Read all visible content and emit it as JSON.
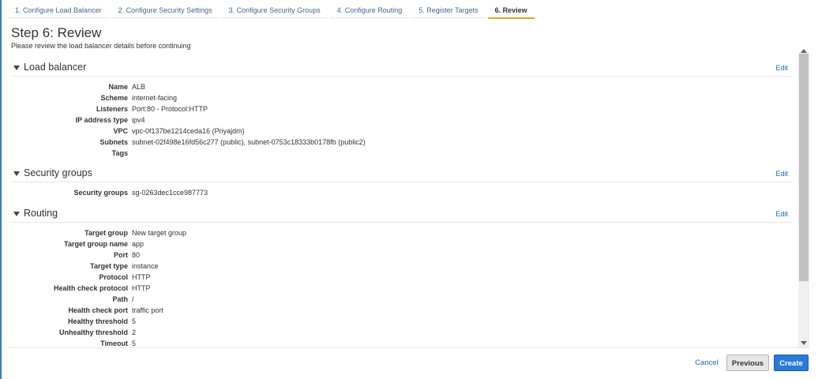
{
  "tabs": [
    {
      "label": "1. Configure Load Balancer"
    },
    {
      "label": "2. Configure Security Settings"
    },
    {
      "label": "3. Configure Security Groups"
    },
    {
      "label": "4. Configure Routing"
    },
    {
      "label": "5. Register Targets"
    },
    {
      "label": "6. Review"
    }
  ],
  "header": {
    "title": "Step 6: Review",
    "subtitle": "Please review the load balancer details before continuing"
  },
  "sections": {
    "load_balancer": {
      "title": "Load balancer",
      "edit": "Edit",
      "rows": [
        {
          "label": "Name",
          "value": "ALB"
        },
        {
          "label": "Scheme",
          "value": "internet-facing"
        },
        {
          "label": "Listeners",
          "value": "Port:80 - Protocol:HTTP"
        },
        {
          "label": "IP address type",
          "value": "ipv4"
        },
        {
          "label": "VPC",
          "value": "vpc-0f137be1214ceda16 (Priyajdm)"
        },
        {
          "label": "Subnets",
          "value": "subnet-02f498e16fd56c277 (public), subnet-0753c18333b0178fb (public2)"
        },
        {
          "label": "Tags",
          "value": ""
        }
      ]
    },
    "security_groups": {
      "title": "Security groups",
      "edit": "Edit",
      "rows": [
        {
          "label": "Security groups",
          "value": "sg-0263dec1cce987773"
        }
      ]
    },
    "routing": {
      "title": "Routing",
      "edit": "Edit",
      "rows": [
        {
          "label": "Target group",
          "value": "New target group"
        },
        {
          "label": "Target group name",
          "value": "app"
        },
        {
          "label": "Port",
          "value": "80"
        },
        {
          "label": "Target type",
          "value": "instance"
        },
        {
          "label": "Protocol",
          "value": "HTTP"
        },
        {
          "label": "Health check protocol",
          "value": "HTTP"
        },
        {
          "label": "Path",
          "value": "/"
        },
        {
          "label": "Health check port",
          "value": "traffic port"
        },
        {
          "label": "Healthy threshold",
          "value": "5"
        },
        {
          "label": "Unhealthy threshold",
          "value": "2"
        },
        {
          "label": "Timeout",
          "value": "5"
        }
      ]
    }
  },
  "footer": {
    "cancel": "Cancel",
    "previous": "Previous",
    "create": "Create"
  },
  "colors": {
    "accent": "#2a7ad6",
    "active_tab_underline": "#e6a817",
    "link": "#1b6bb4"
  }
}
